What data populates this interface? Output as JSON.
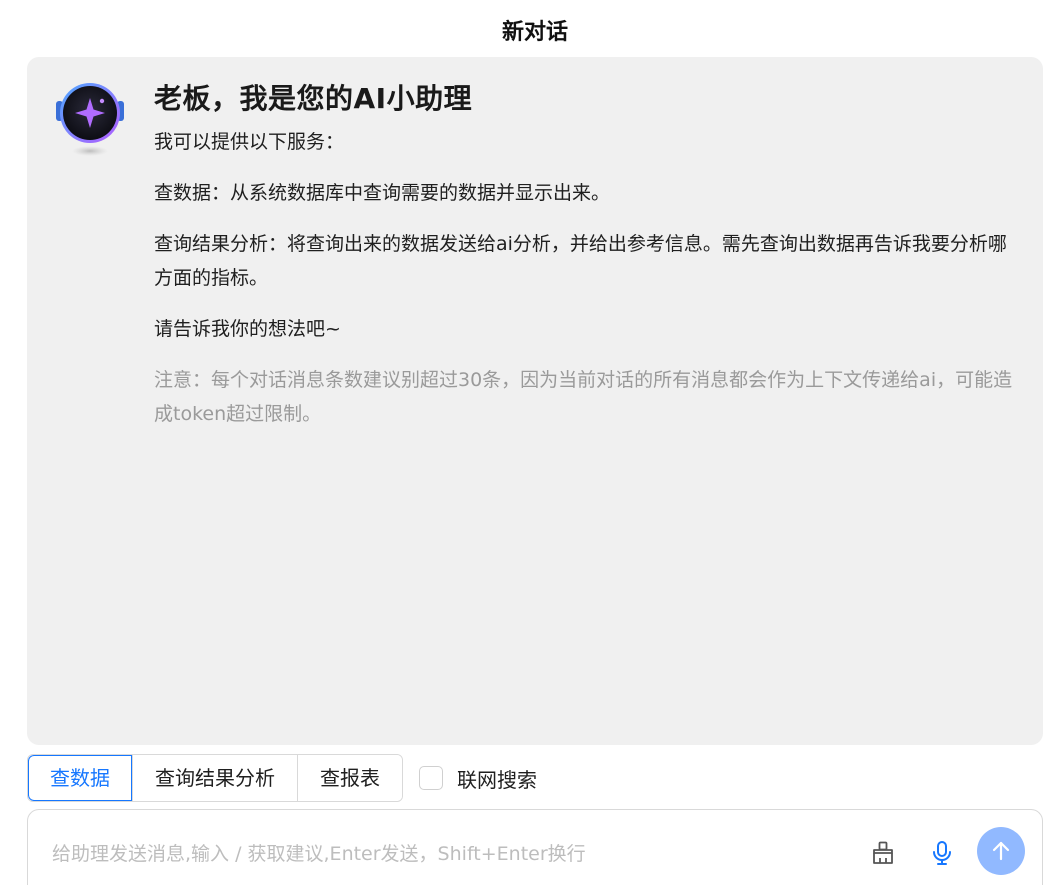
{
  "header": {
    "title": "新对话"
  },
  "assistant": {
    "heading": "老板，我是您的AI小助理",
    "intro": "我可以提供以下服务：",
    "services": [
      "查数据：从系统数据库中查询需要的数据并显示出来。",
      "查询结果分析：将查询出来的数据发送给ai分析，并给出参考信息。需先查询出数据再告诉我要分析哪方面的指标。"
    ],
    "prompt": "请告诉我你的想法吧~",
    "note": "注意：每个对话消息条数建议别超过30条，因为当前对话的所有消息都会作为上下文传递给ai，可能造成token超过限制。"
  },
  "mode_tabs": [
    {
      "label": "查数据",
      "active": true
    },
    {
      "label": "查询结果分析",
      "active": false
    },
    {
      "label": "查报表",
      "active": false
    }
  ],
  "web_search": {
    "label": "联网搜索",
    "checked": false
  },
  "composer": {
    "value": "",
    "placeholder": "给助理发送消息,输入 / 获取建议,Enter发送，Shift+Enter换行"
  },
  "colors": {
    "accent": "#1677ff",
    "panel_bg": "#f0f0f0",
    "send_button": "#91b9ff",
    "note_text": "#9a9a9a"
  },
  "icons": {
    "avatar": "ai-robot-avatar-icon",
    "clear": "broom-icon",
    "mic": "microphone-icon",
    "send": "arrow-up-icon"
  }
}
